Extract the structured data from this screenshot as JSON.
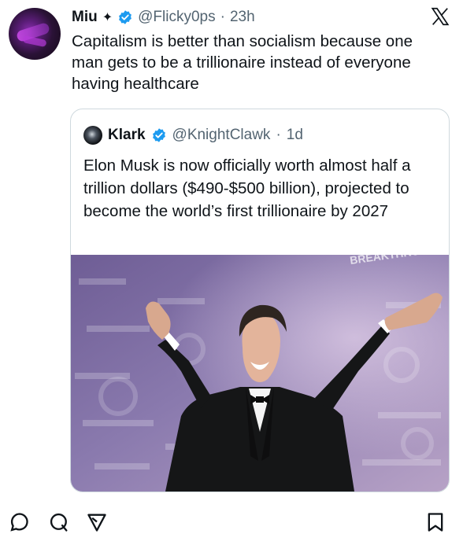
{
  "post": {
    "author_name": "Miu",
    "author_handle": "@Flicky0ps",
    "separator": "·",
    "time": "23h",
    "text": "Capitalism is better than socialism because one man gets to be a trillionaire instead of everyone having healthcare"
  },
  "quoted_post": {
    "author_name": "Klark",
    "author_handle": "@KnightClawk",
    "separator": "·",
    "time": "1d",
    "text": "Elon Musk is now officially worth almost half a trillion dollars ($490-$500 billion), projected to become the world’s first trillionaire by 2027",
    "image_banner_text": "BREAKTHROUGH PRIZE"
  },
  "icons": {
    "header": [
      "sparkle-icon",
      "verified-badge-icon",
      "x-logo-icon"
    ],
    "actions": [
      "reply-icon",
      "repost-icon",
      "share-icon",
      "bookmark-icon"
    ]
  },
  "colors": {
    "text": "#0f1419",
    "secondary_text": "#536471",
    "verified": "#1d9bf0",
    "border": "#cfd9de",
    "background": "#ffffff"
  }
}
